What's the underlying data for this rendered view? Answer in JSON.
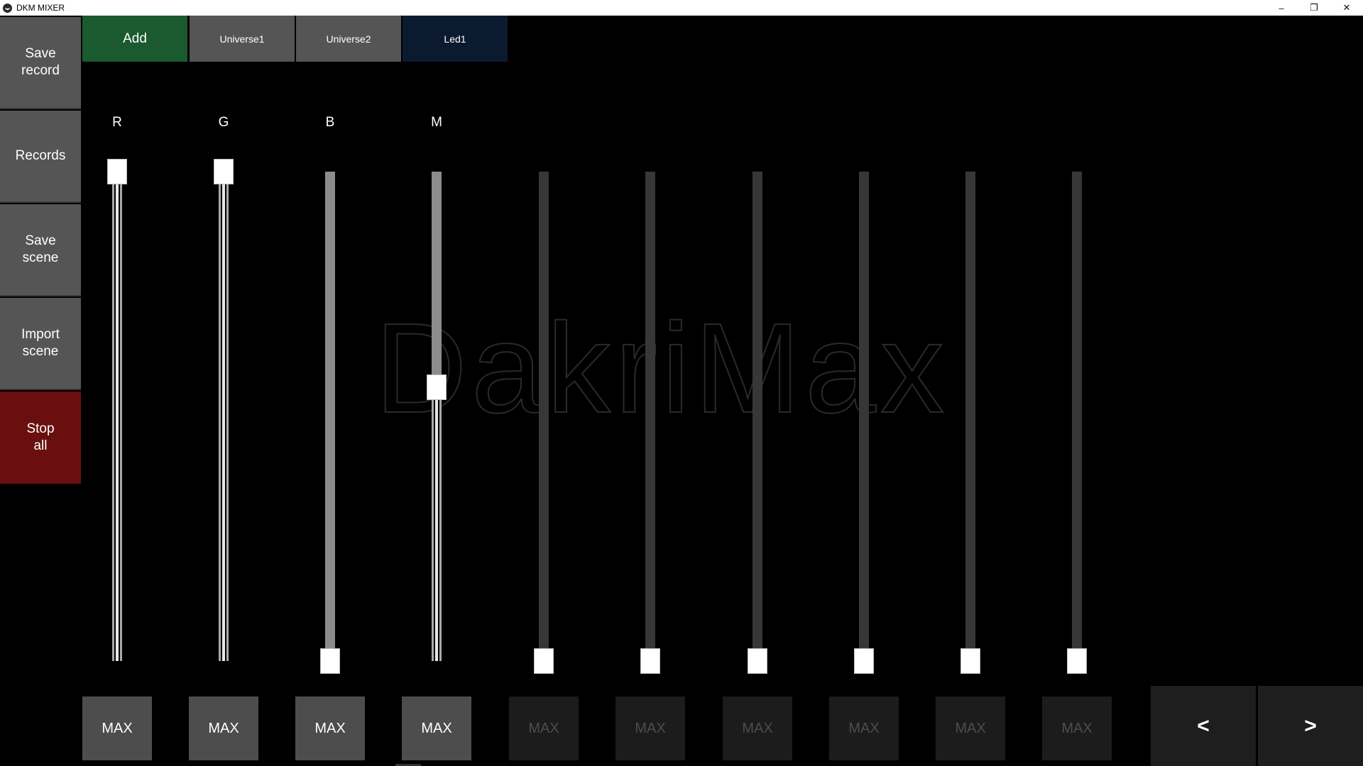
{
  "window": {
    "title": "DKM MIXER",
    "controls": [
      "–",
      "❐",
      "✕"
    ]
  },
  "sidebar": {
    "items": [
      {
        "label": "Save\nrecord"
      },
      {
        "label": "Records"
      },
      {
        "label": "Save\nscene"
      },
      {
        "label": "Import\nscene"
      },
      {
        "label": "Stop\nall"
      }
    ]
  },
  "tabs": [
    {
      "label": "Add"
    },
    {
      "label": "Universe1"
    },
    {
      "label": "Universe2"
    },
    {
      "label": "Led1"
    }
  ],
  "watermark": {
    "text": "DakriMax"
  },
  "channels": [
    {
      "label": "R",
      "level": 1.0,
      "active": true,
      "max_label": "MAX"
    },
    {
      "label": "G",
      "level": 1.0,
      "active": true,
      "max_label": "MAX"
    },
    {
      "label": "B",
      "level": 0.0,
      "active": true,
      "max_label": "MAX"
    },
    {
      "label": "M",
      "level": 0.56,
      "active": true,
      "max_label": "MAX"
    },
    {
      "label": "",
      "level": 0.0,
      "active": false,
      "max_label": "MAX"
    },
    {
      "label": "",
      "level": 0.0,
      "active": false,
      "max_label": "MAX"
    },
    {
      "label": "",
      "level": 0.0,
      "active": false,
      "max_label": "MAX"
    },
    {
      "label": "",
      "level": 0.0,
      "active": false,
      "max_label": "MAX"
    },
    {
      "label": "",
      "level": 0.0,
      "active": false,
      "max_label": "MAX"
    },
    {
      "label": "",
      "level": 0.0,
      "active": false,
      "max_label": "MAX"
    }
  ],
  "nav": {
    "prev_label": "<",
    "next_label": ">"
  },
  "colors": {
    "background": "#000000",
    "add_tab": "#1a5a2e",
    "active_tab": "#0c1a30",
    "stop_all": "#6a0f0f",
    "button_gray": "#555555"
  }
}
